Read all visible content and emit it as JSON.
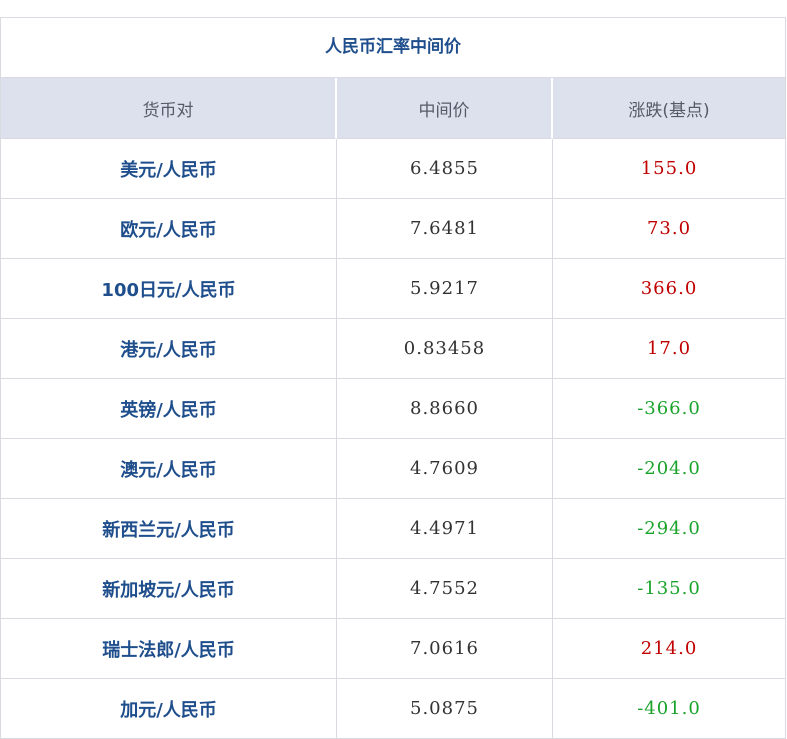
{
  "table": {
    "title": "人民币汇率中间价",
    "headers": [
      "货币对",
      "中间价",
      "涨跌(基点)"
    ],
    "rows": [
      {
        "pair": "美元/人民币",
        "mid": "6.4855",
        "change": "155.0",
        "dir": "up"
      },
      {
        "pair": "欧元/人民币",
        "mid": "7.6481",
        "change": "73.0",
        "dir": "up"
      },
      {
        "pair": "100日元/人民币",
        "mid": "5.9217",
        "change": "366.0",
        "dir": "up"
      },
      {
        "pair": "港元/人民币",
        "mid": "0.83458",
        "change": "17.0",
        "dir": "up"
      },
      {
        "pair": "英镑/人民币",
        "mid": "8.8660",
        "change": "-366.0",
        "dir": "down"
      },
      {
        "pair": "澳元/人民币",
        "mid": "4.7609",
        "change": "-204.0",
        "dir": "down"
      },
      {
        "pair": "新西兰元/人民币",
        "mid": "4.4971",
        "change": "-294.0",
        "dir": "down"
      },
      {
        "pair": "新加坡元/人民币",
        "mid": "4.7552",
        "change": "-135.0",
        "dir": "down"
      },
      {
        "pair": "瑞士法郎/人民币",
        "mid": "7.0616",
        "change": "214.0",
        "dir": "up"
      },
      {
        "pair": "加元/人民币",
        "mid": "5.0875",
        "change": "-401.0",
        "dir": "down"
      }
    ]
  },
  "colors": {
    "up": "#c00000",
    "down": "#1aa32a",
    "pair": "#1f4e8c",
    "header_bg": "#dde1ee"
  }
}
